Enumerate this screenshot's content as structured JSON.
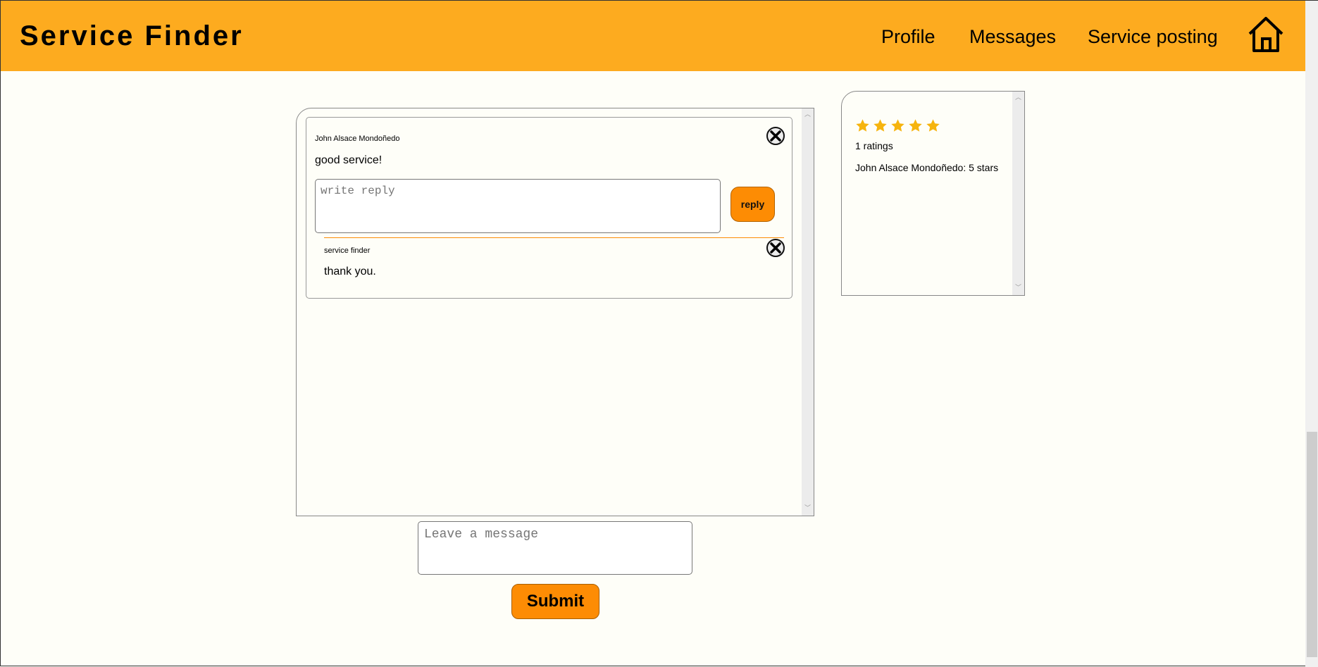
{
  "header": {
    "brand": "Service Finder",
    "nav": [
      "Profile",
      "Messages",
      "Service posting"
    ],
    "home_icon": "home-icon"
  },
  "colors": {
    "header_bg": "#fdab1f",
    "accent": "#fd8c04",
    "star": "#f6b40e",
    "page_bg": "#fefef8"
  },
  "comments": [
    {
      "author": "John Alsace Mondoñedo",
      "text": "good service!",
      "reply_placeholder": "write reply",
      "reply_button": "reply",
      "replies": [
        {
          "author": "service finder",
          "text": "thank you."
        }
      ]
    }
  ],
  "ratings": {
    "stars": 5,
    "count_text": "1 ratings",
    "entries": [
      "John Alsace Mondoñedo: 5 stars"
    ]
  },
  "message_form": {
    "placeholder": "Leave a message",
    "submit_label": "Submit"
  }
}
